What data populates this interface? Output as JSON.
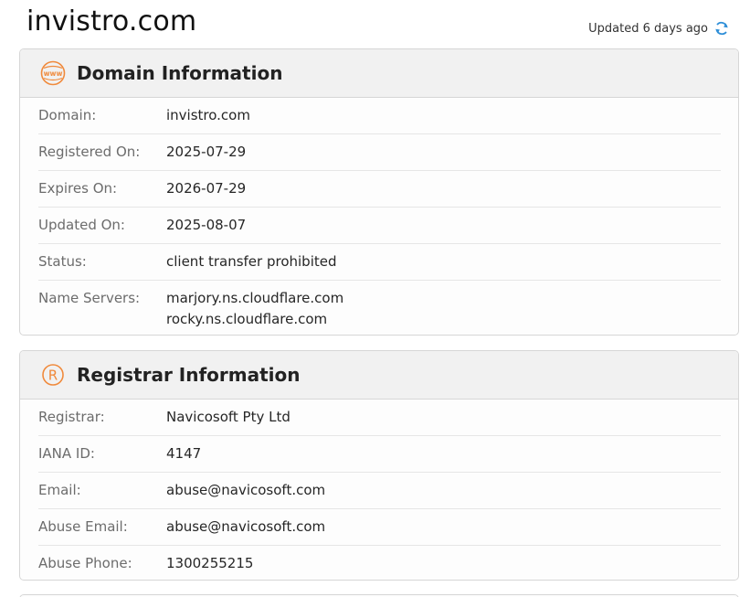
{
  "header": {
    "domain": "invistro.com",
    "updated_text": "Updated 6 days ago"
  },
  "domain_info": {
    "title": "Domain Information",
    "rows": [
      {
        "label": "Domain:",
        "value": "invistro.com"
      },
      {
        "label": "Registered On:",
        "value": "2025-07-29"
      },
      {
        "label": "Expires On:",
        "value": "2026-07-29"
      },
      {
        "label": "Updated On:",
        "value": "2025-08-07"
      },
      {
        "label": "Status:",
        "value": "client transfer prohibited"
      },
      {
        "label": "Name Servers:",
        "values": [
          "marjory.ns.cloudflare.com",
          "rocky.ns.cloudflare.com"
        ]
      }
    ]
  },
  "registrar_info": {
    "title": "Registrar Information",
    "rows": [
      {
        "label": "Registrar:",
        "value": "Navicosoft Pty Ltd"
      },
      {
        "label": "IANA ID:",
        "value": "4147"
      },
      {
        "label": "Email:",
        "value": "abuse@navicosoft.com"
      },
      {
        "label": "Abuse Email:",
        "value": "abuse@navicosoft.com"
      },
      {
        "label": "Abuse Phone:",
        "value": "1300255215"
      }
    ]
  },
  "icons": {
    "www": "www-globe-icon",
    "registered": "registered-trademark-icon",
    "refresh": "refresh-icon"
  },
  "colors": {
    "accent": "#f08a3c",
    "refresh": "#2f8fd8"
  }
}
